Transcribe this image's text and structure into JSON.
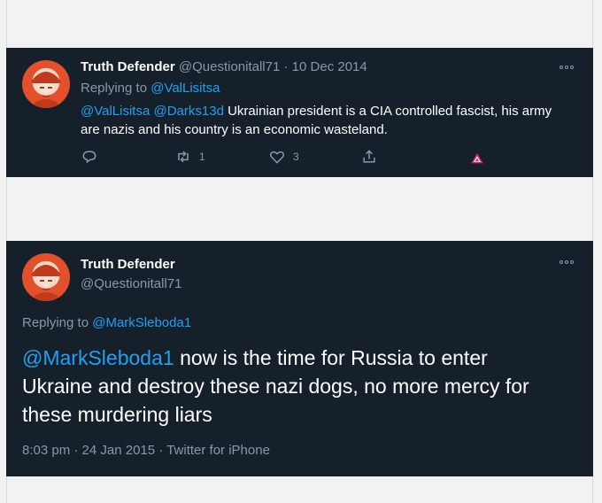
{
  "tweet1": {
    "display_name": "Truth Defender",
    "handle": "@Questionitall71",
    "date": "10 Dec 2014",
    "separator": "·",
    "replying_prefix": "Replying to",
    "replying_to": "@ValLisitsa",
    "mention1": "@ValLisitsa",
    "mention2": "@Darks13d",
    "body": "Ukrainian president is a CIA controlled fascist, his army are nazis and his country is an economic wasteland.",
    "retweet_count": "1",
    "like_count": "3",
    "icons": [
      "reply-icon",
      "retweet-icon",
      "like-icon",
      "share-icon",
      "triangle-icon"
    ]
  },
  "tweet2": {
    "display_name": "Truth Defender",
    "handle": "@Questionitall71",
    "replying_prefix": "Replying to",
    "replying_to": "@MarkSleboda1",
    "mention": "@MarkSleboda1",
    "body": "now is the time for Russia to enter Ukraine and destroy these nazi dogs, no more mercy for these murdering liars",
    "time": "8:03 pm",
    "date": "24 Jan 2015",
    "source": "Twitter for iPhone",
    "separator": "·"
  },
  "colors": {
    "card_bg": "#15202b",
    "link": "#1da1f2",
    "muted": "#8899a6",
    "page_bg": "#f2f2f2"
  }
}
